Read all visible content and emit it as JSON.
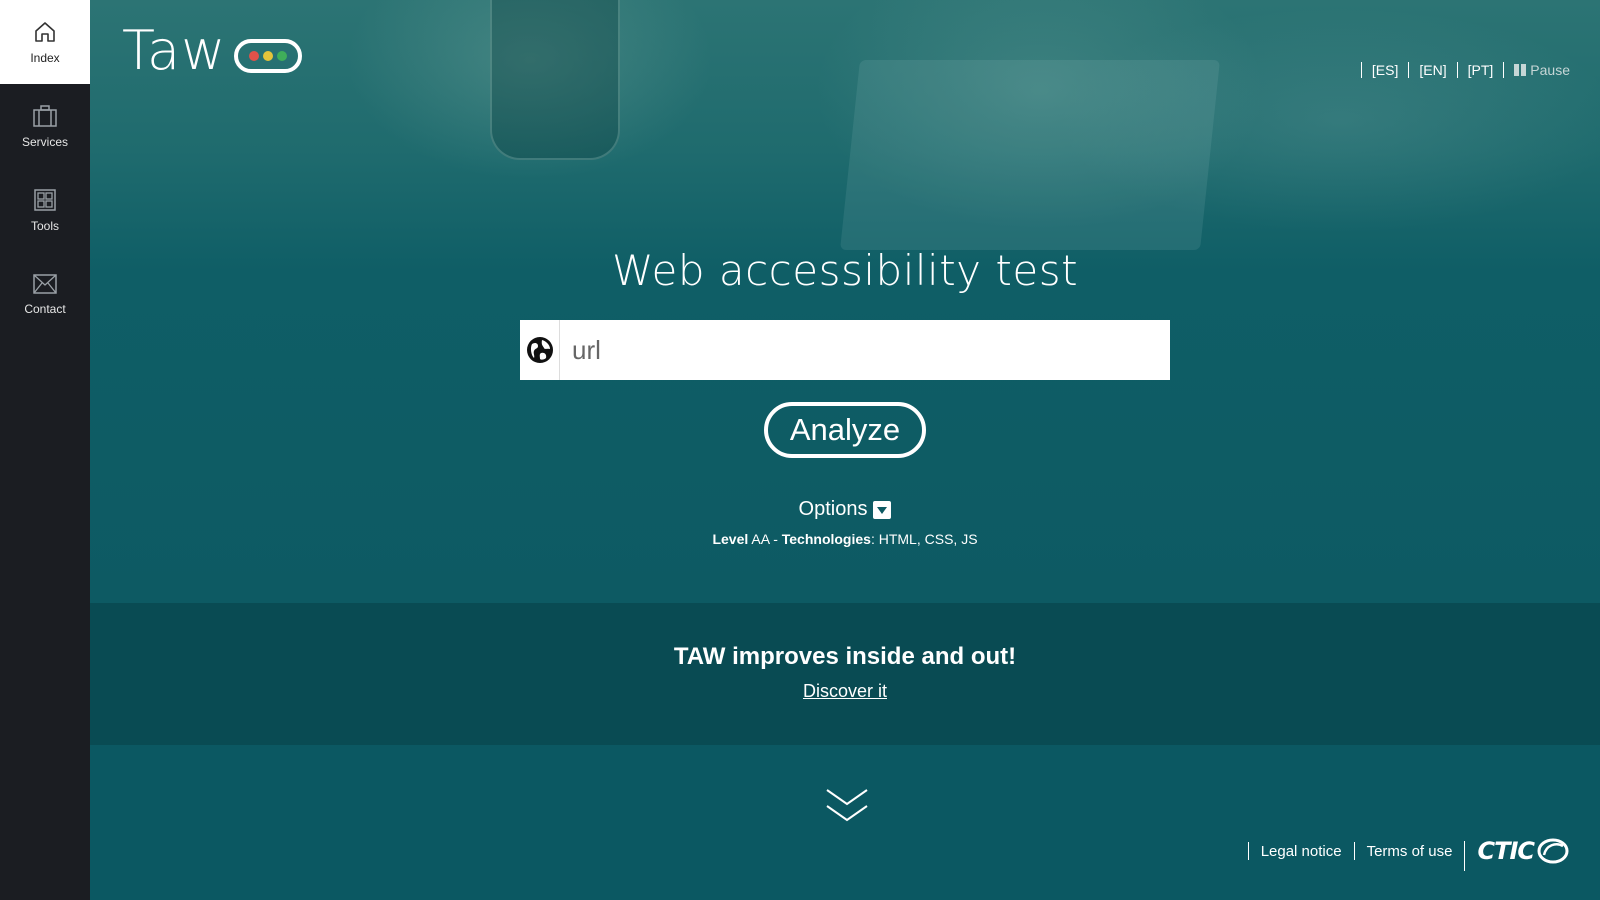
{
  "sidebar": {
    "items": [
      {
        "label": "Index",
        "icon": "home-icon",
        "active": true
      },
      {
        "label": "Services",
        "icon": "briefcase-icon"
      },
      {
        "label": "Tools",
        "icon": "grid-icon"
      },
      {
        "label": "Contact",
        "icon": "envelope-icon"
      }
    ]
  },
  "header": {
    "logo_text": "Taw",
    "lights": [
      "#e0524a",
      "#e5c43a",
      "#3fae5a"
    ],
    "languages": [
      "[ES]",
      "[EN]",
      "[PT]"
    ],
    "pause_label": "Pause"
  },
  "hero": {
    "title": "Web accessibility test",
    "url_placeholder": "url",
    "analyze_label": "Analyze",
    "options_label": "Options",
    "summary": {
      "level_label": "Level",
      "level_value": " AA - ",
      "tech_label": "Technologies",
      "tech_value": ": HTML, CSS, JS"
    }
  },
  "band": {
    "title": "TAW improves inside and out!",
    "link": "Discover it"
  },
  "footer": {
    "legal": "Legal notice",
    "terms": "Terms of use",
    "brand": "CTIC"
  },
  "colors": {
    "sidebar_bg": "#1b1d22",
    "hero_teal": "#0d5a63",
    "band_bg": "#094b53"
  }
}
